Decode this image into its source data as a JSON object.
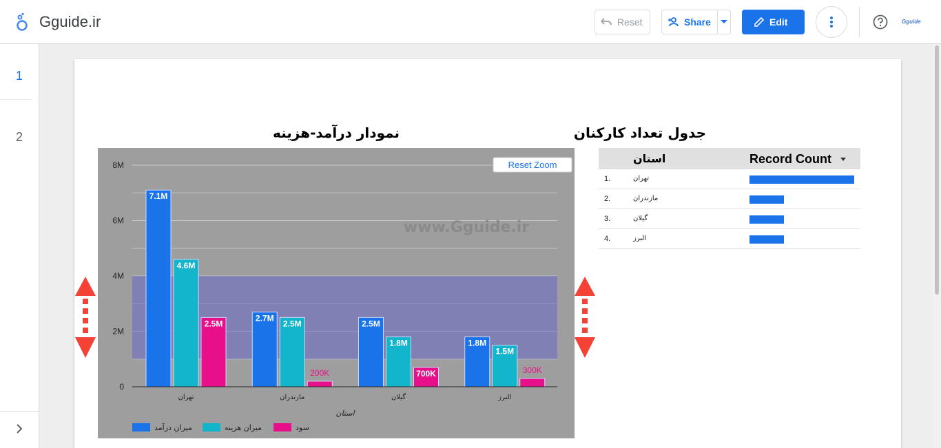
{
  "app": {
    "title": "Gguide.ir",
    "mini_logo": "Gguide"
  },
  "toolbar": {
    "reset_label": "Reset",
    "share_label": "Share",
    "edit_label": "Edit"
  },
  "pages": [
    {
      "label": "1",
      "active": true
    },
    {
      "label": "2",
      "active": false
    }
  ],
  "chart": {
    "title": "نمودار درآمد-هزینه",
    "reset_zoom_label": "Reset Zoom",
    "watermark": "www.Gguide.ir"
  },
  "chart_data": {
    "type": "bar",
    "title": "نمودار درآمد-هزینه",
    "xlabel": "استان",
    "ylabel": "",
    "categories": [
      "تهران",
      "مازندران",
      "گیلان",
      "البرز"
    ],
    "yticks": [
      "0",
      "2M",
      "4M",
      "6M",
      "8M"
    ],
    "ylim": [
      0,
      8000000
    ],
    "series": [
      {
        "name": "میزان درآمد",
        "color": "#1a73e8",
        "values": [
          7100000,
          2700000,
          2500000,
          1800000
        ],
        "labels": [
          "7.1M",
          "2.7M",
          "2.5M",
          "1.8M"
        ]
      },
      {
        "name": "میزان هزینه",
        "color": "#12b5cb",
        "values": [
          4600000,
          2500000,
          1800000,
          1500000
        ],
        "labels": [
          "4.6M",
          "2.5M",
          "1.8M",
          "1.5M"
        ]
      },
      {
        "name": "سود",
        "color": "#e8108a",
        "values": [
          2500000,
          200000,
          700000,
          300000
        ],
        "labels": [
          "2.5M",
          "200K",
          "700K",
          "300K"
        ]
      }
    ],
    "highlight_band": [
      1000000,
      4000000
    ],
    "legend_position": "bottom-left"
  },
  "table": {
    "title": "جدول تعداد کارکنان",
    "col_state": "استان",
    "col_count": "Record Count",
    "rows": [
      {
        "idx": "1.",
        "state": "تهران",
        "fraction": 1.0
      },
      {
        "idx": "2.",
        "state": "مازندران",
        "fraction": 0.33
      },
      {
        "idx": "3.",
        "state": "گیلان",
        "fraction": 0.33
      },
      {
        "idx": "4.",
        "state": "البرز",
        "fraction": 0.33
      }
    ]
  },
  "colors": {
    "accent": "#1a73e8",
    "arrow": "#f44336"
  }
}
